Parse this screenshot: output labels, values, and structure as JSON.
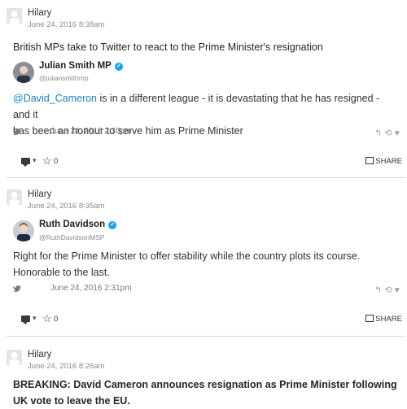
{
  "posts": [
    {
      "author": "Hilary",
      "time": "June 24, 2016 8:38am",
      "headline": "British MPs take to Twitter to react to the Prime Minister's resignation",
      "tweet": {
        "name": "Julian Smith MP",
        "handle": "@juliansmithmp",
        "mention": "@David_Cameron",
        "text_line1": " is in a different league - it is devastating that he has resigned - and it",
        "text_line2": "has been an honour to serve him as Prime Minister",
        "date": "June 24, 2016 2:30pm"
      },
      "star_count": "0",
      "share_label": "SHARE"
    },
    {
      "author": "Hilary",
      "time": "June 24, 2016 8:35am",
      "tweet": {
        "name": "Ruth Davidson",
        "handle": "@RuthDavidsonMSP",
        "text_line1": "Right for the Prime Minister to offer stability while the country plots its course.",
        "text_line2": "Honorable to the last.",
        "date": "June 24, 2016 2:31pm"
      },
      "star_count": "0",
      "share_label": "SHARE"
    },
    {
      "author": "Hilary",
      "time": "June 24, 2016 8:26am",
      "headline_line1": "BREAKING: David Cameron announces resignation as Prime Minister following",
      "headline_line2": "UK vote to leave the EU."
    }
  ],
  "icons": {
    "verified": "verified-badge-icon",
    "bird": "twitter-bird-icon",
    "reply": "reply-icon",
    "retweet": "retweet-icon",
    "like": "heart-icon",
    "comment": "comment-icon",
    "star": "star-icon",
    "share": "share-icon"
  },
  "colors": {
    "mention": "#1d7fc4",
    "verified": "#1da1f2",
    "divider": "#d9d9d9"
  }
}
